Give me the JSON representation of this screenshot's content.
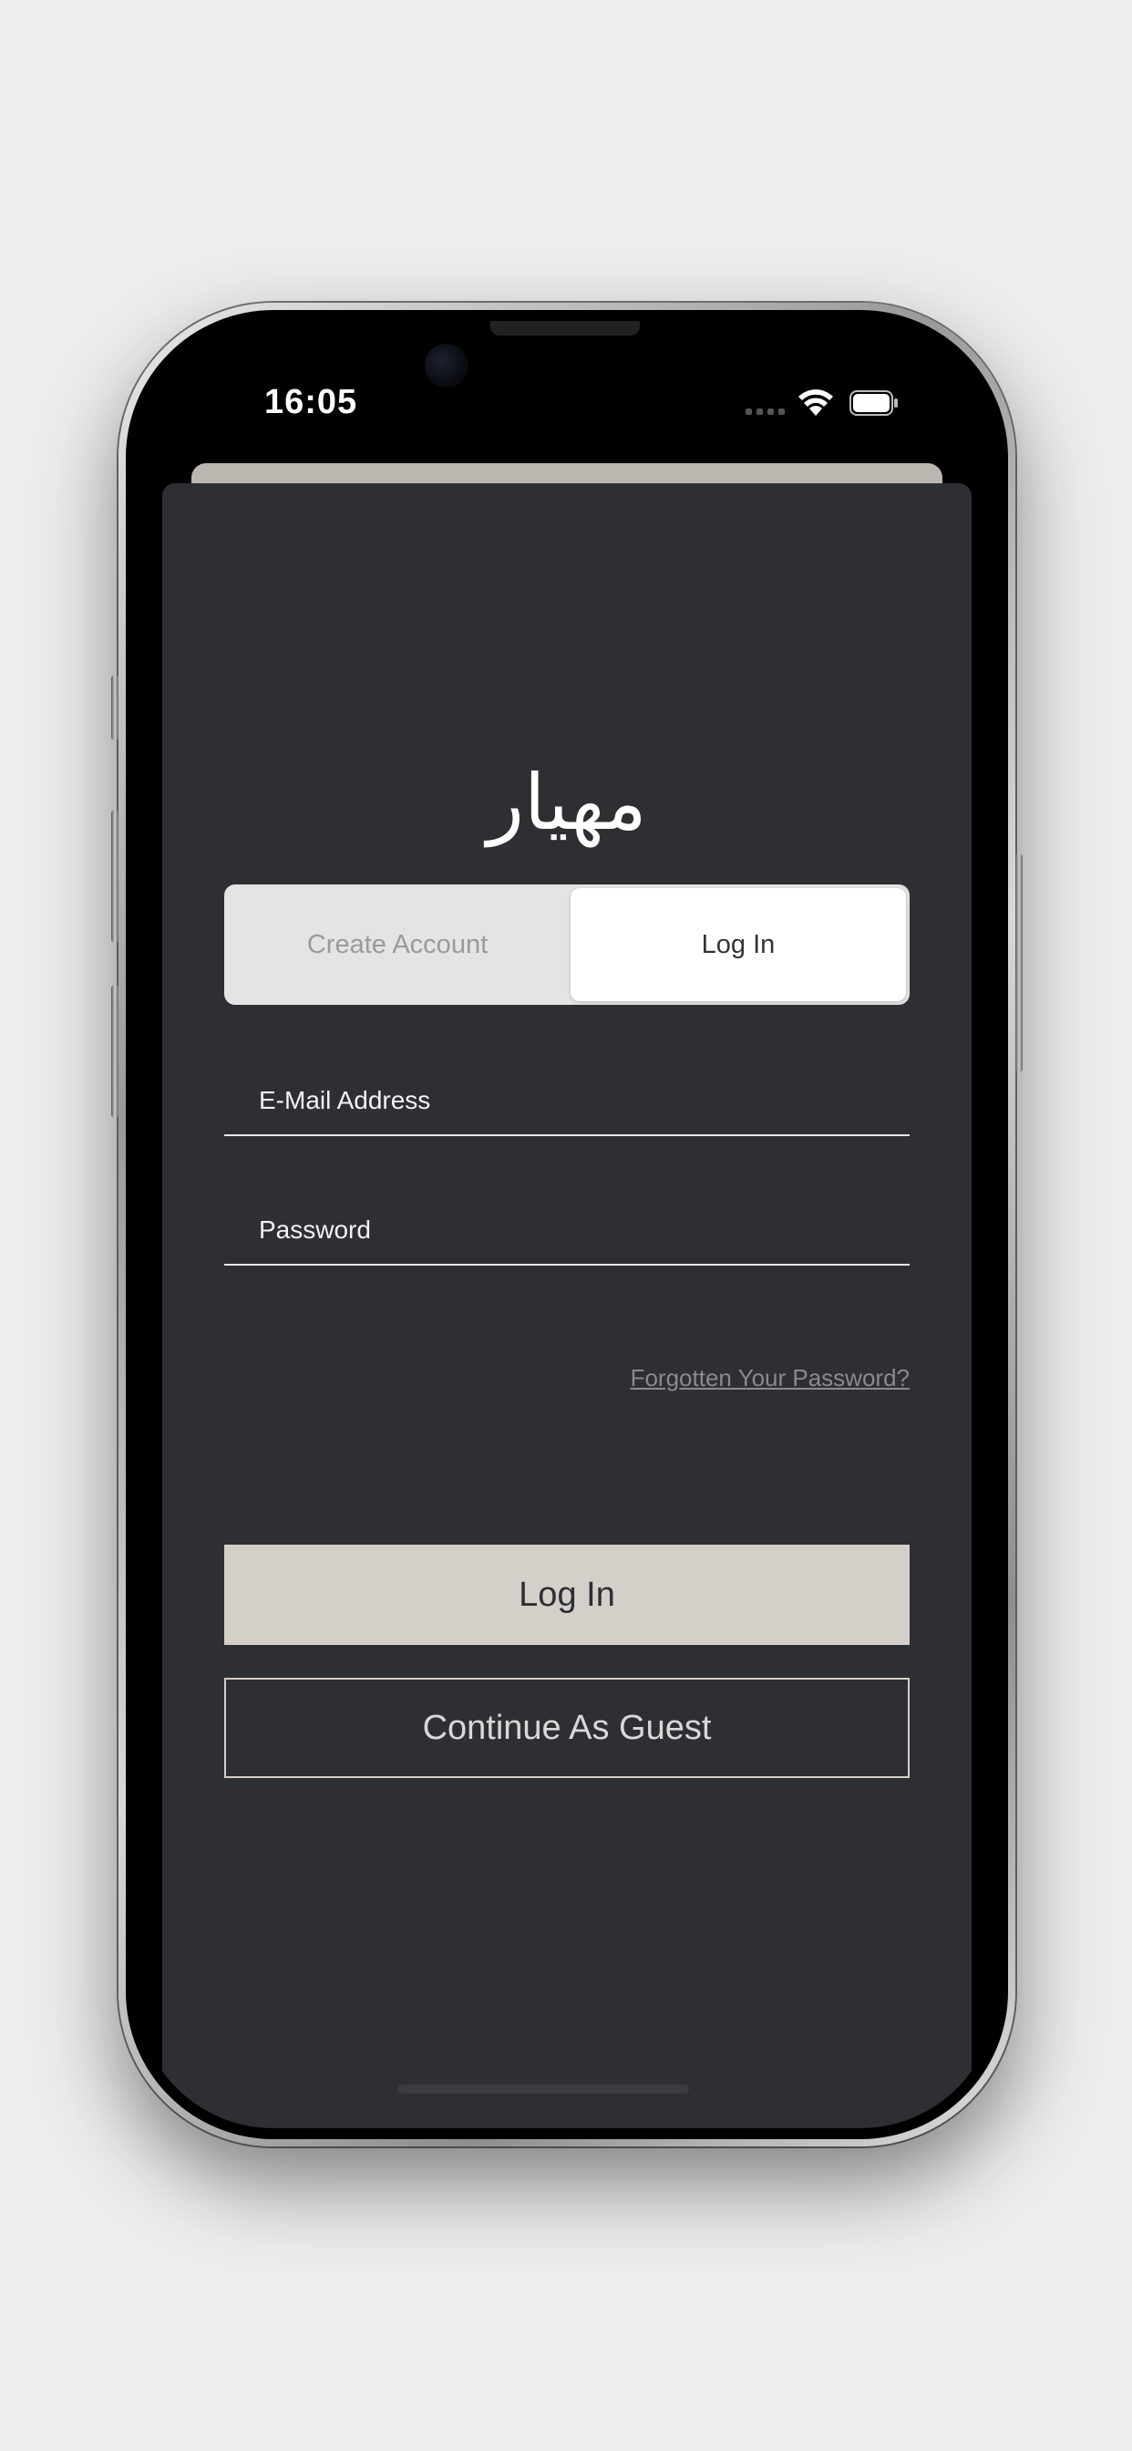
{
  "status_bar": {
    "time": "16:05",
    "icons": [
      "cellular-signal-icon",
      "wifi-icon",
      "battery-icon"
    ]
  },
  "app": {
    "logo_text": "مهيار"
  },
  "auth_tabs": {
    "create_account_label": "Create Account",
    "login_label": "Log In",
    "selected": "Log In"
  },
  "form": {
    "email_placeholder": "E-Mail Address",
    "email_value": "",
    "password_placeholder": "Password",
    "password_value": "",
    "forgot_password_label": "Forgotten Your Password?"
  },
  "actions": {
    "login_button_label": "Log In",
    "guest_button_label": "Continue As Guest"
  },
  "colors": {
    "background": "#ededed",
    "sheet": "#2e2f33",
    "accent_button": "#d4cfc9",
    "tab_selected": "#ffffff",
    "tab_unselected": "#e4e4e4"
  }
}
